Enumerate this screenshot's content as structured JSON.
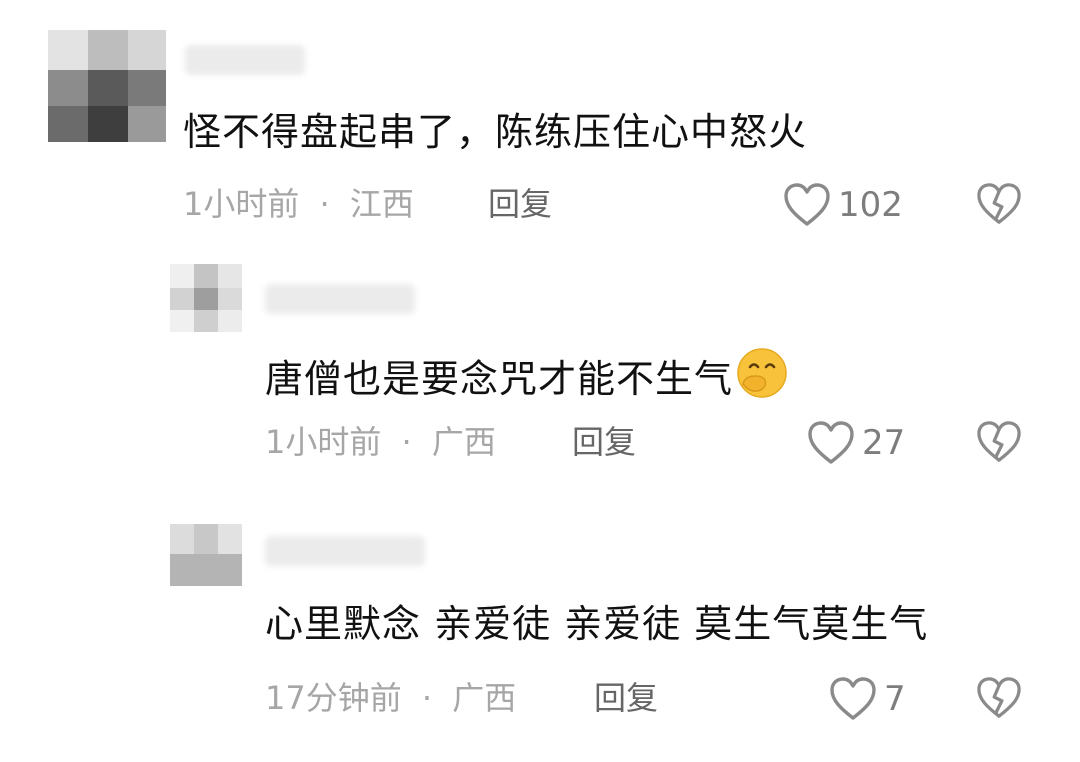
{
  "comments": [
    {
      "text": "怪不得盘起串了，陈练压住心中怒火",
      "time": "1小时前",
      "location": "江西",
      "reply_label": "回复",
      "likes": "102"
    },
    {
      "text": "唐僧也是要念咒才能不生气",
      "emoji": "smiling-face-with-hand-over-mouth",
      "time": "1小时前",
      "location": "广西",
      "reply_label": "回复",
      "likes": "27"
    },
    {
      "text": "心里默念 亲爱徒 亲爱徒 莫生气莫生气",
      "time": "17分钟前",
      "location": "广西",
      "reply_label": "回复",
      "likes": "7"
    }
  ],
  "meta_separator": "·",
  "colors": {
    "text": "#111111",
    "meta": "#a6a6a6",
    "icon": "#8a8a8a",
    "background": "#ffffff"
  },
  "icons": [
    "heart-outline-icon",
    "broken-heart-icon",
    "emoji-icon"
  ]
}
